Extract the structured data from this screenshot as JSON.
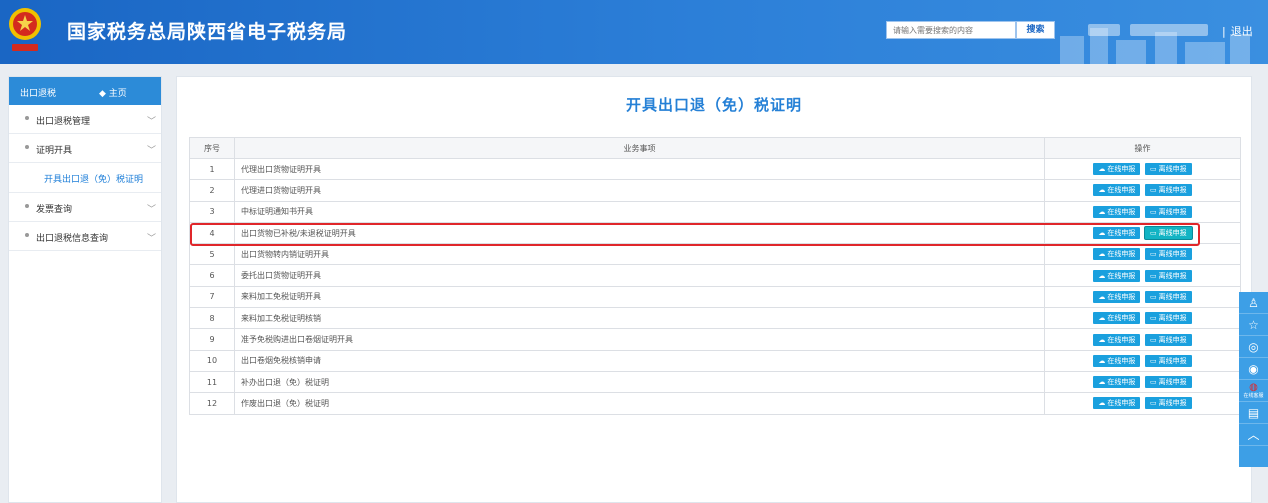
{
  "header": {
    "site_title": "国家税务总局陕西省电子税务局",
    "search_placeholder": "请输入需要搜索的内容",
    "search_button": "搜索",
    "logout_sep": "|",
    "logout": "退出"
  },
  "sidebar": {
    "title": "出口退税",
    "home": "主页",
    "items": [
      {
        "label": "出口退税管理"
      },
      {
        "label": "证明开具"
      },
      {
        "label": "开具出口退（免）税证明"
      },
      {
        "label": "发票查询"
      },
      {
        "label": "出口退税信息查询"
      }
    ]
  },
  "main": {
    "page_title": "开具出口退（免）税证明",
    "columns": [
      "序号",
      "业务事项",
      "操作"
    ],
    "online_label": "在线申报",
    "offline_label": "离线申报",
    "rows": [
      {
        "no": "1",
        "item": "代理出口货物证明开具"
      },
      {
        "no": "2",
        "item": "代理进口货物证明开具"
      },
      {
        "no": "3",
        "item": "中标证明通知书开具"
      },
      {
        "no": "4",
        "item": "出口货物已补税/未退税证明开具"
      },
      {
        "no": "5",
        "item": "出口货物转内销证明开具"
      },
      {
        "no": "6",
        "item": "委托出口货物证明开具"
      },
      {
        "no": "7",
        "item": "来料加工免税证明开具"
      },
      {
        "no": "8",
        "item": "来料加工免税证明核销"
      },
      {
        "no": "9",
        "item": "准予免税购进出口卷烟证明开具"
      },
      {
        "no": "10",
        "item": "出口卷烟免税核销申请"
      },
      {
        "no": "11",
        "item": "补办出口退（免）税证明"
      },
      {
        "no": "12",
        "item": "作废出口退（免）税证明"
      }
    ]
  },
  "float_bar": {
    "online_service_label": "在线客服"
  },
  "colors": {
    "header": "#1a66c4",
    "accent": "#2580d6",
    "button": "#1aa0de",
    "highlight": "#e0262a"
  }
}
